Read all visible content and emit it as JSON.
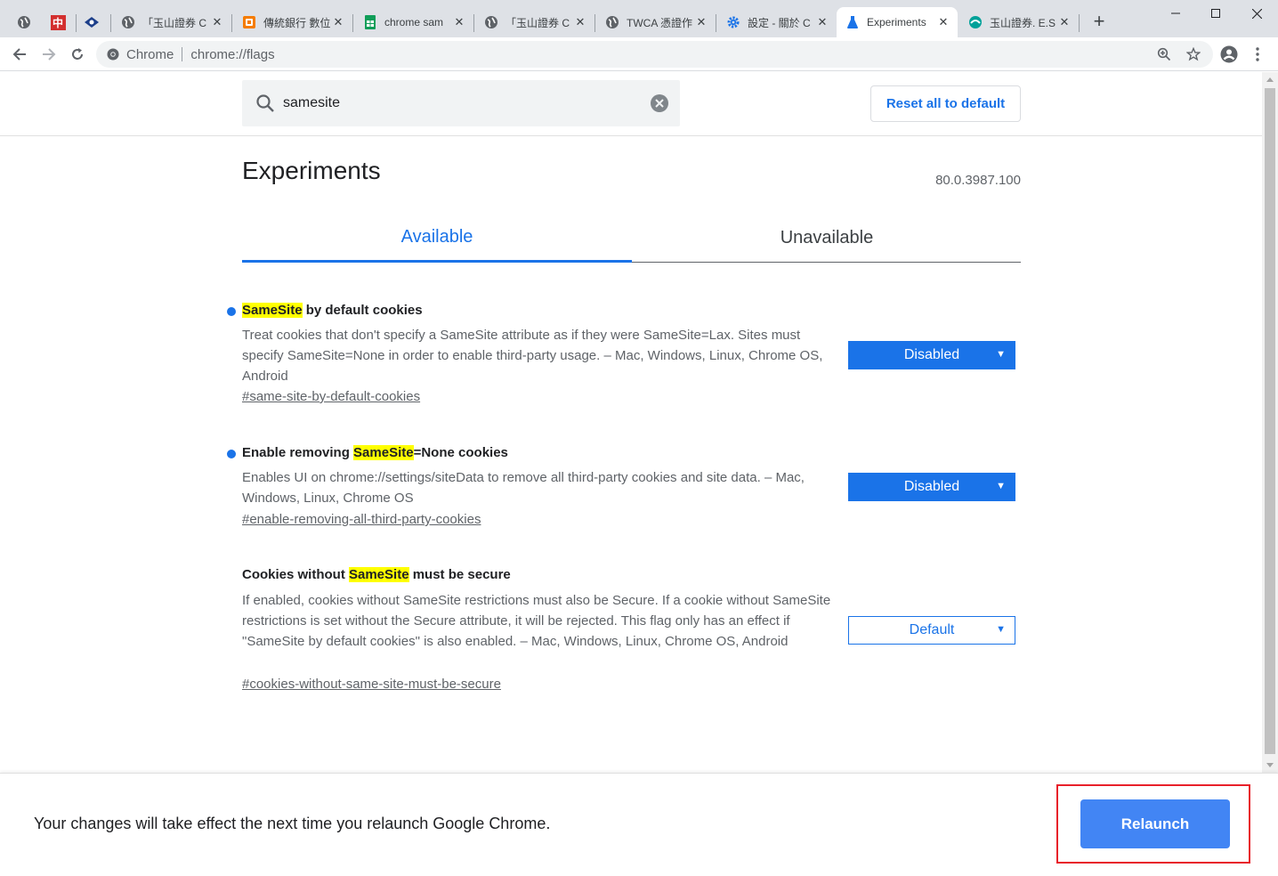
{
  "browser": {
    "tabs": [
      {
        "title": "「玉山證券 C",
        "icon": "globe-icon"
      },
      {
        "title": "傳統銀行 數位",
        "icon": "orange-app-icon"
      },
      {
        "title": "chrome sam",
        "icon": "sheets-icon"
      },
      {
        "title": "「玉山證券 C",
        "icon": "globe-icon"
      },
      {
        "title": "TWCA 憑證作",
        "icon": "globe-icon"
      },
      {
        "title": "設定 - 關於 C",
        "icon": "gear-icon"
      },
      {
        "title": "Experiments",
        "icon": "flask-icon",
        "active": true
      },
      {
        "title": "玉山證券. E.S",
        "icon": "esun-icon"
      }
    ],
    "pinned": [
      {
        "icon": "globe-icon"
      },
      {
        "icon": "red-chinese-icon",
        "glyph": "中"
      },
      {
        "icon": "eye-icon"
      }
    ],
    "new_tab_label": "+",
    "omnibox": {
      "site": "Chrome",
      "url": "chrome://flags"
    },
    "accent_color": "#1a73e8"
  },
  "header": {
    "search_value": "samesite",
    "reset_label": "Reset all to default"
  },
  "main": {
    "title": "Experiments",
    "version": "80.0.3987.100",
    "tabs": [
      {
        "label": "Available",
        "selected": true
      },
      {
        "label": "Unavailable",
        "selected": false
      }
    ]
  },
  "flags": [
    {
      "name_pre": "",
      "name_hl": "SameSite",
      "name_post": " by default cookies",
      "description": "Treat cookies that don't specify a SameSite attribute as if they were SameSite=Lax. Sites must specify SameSite=None in order to enable third-party usage. – Mac, Windows, Linux, Chrome OS, Android",
      "link": "#same-site-by-default-cookies",
      "value": "Disabled",
      "modified": true
    },
    {
      "name_pre": "Enable removing ",
      "name_hl": "SameSite",
      "name_post": "=None cookies",
      "description": "Enables UI on chrome://settings/siteData to remove all third-party cookies and site data. – Mac, Windows, Linux, Chrome OS",
      "link": "#enable-removing-all-third-party-cookies",
      "value": "Disabled",
      "modified": true
    },
    {
      "name_pre": "Cookies without ",
      "name_hl": "SameSite",
      "name_post": " must be secure",
      "description": "If enabled, cookies without SameSite restrictions must also be Secure. If a cookie without SameSite restrictions is set without the Secure attribute, it will be rejected. This flag only has an effect if \"SameSite by default cookies\" is also enabled. – Mac, Windows, Linux, Chrome OS, Android",
      "link": "#cookies-without-same-site-must-be-secure",
      "value": "Default",
      "modified": false
    }
  ],
  "caret": "▼",
  "footer": {
    "message": "Your changes will take effect the next time you relaunch Google Chrome.",
    "relaunch_label": "Relaunch"
  }
}
